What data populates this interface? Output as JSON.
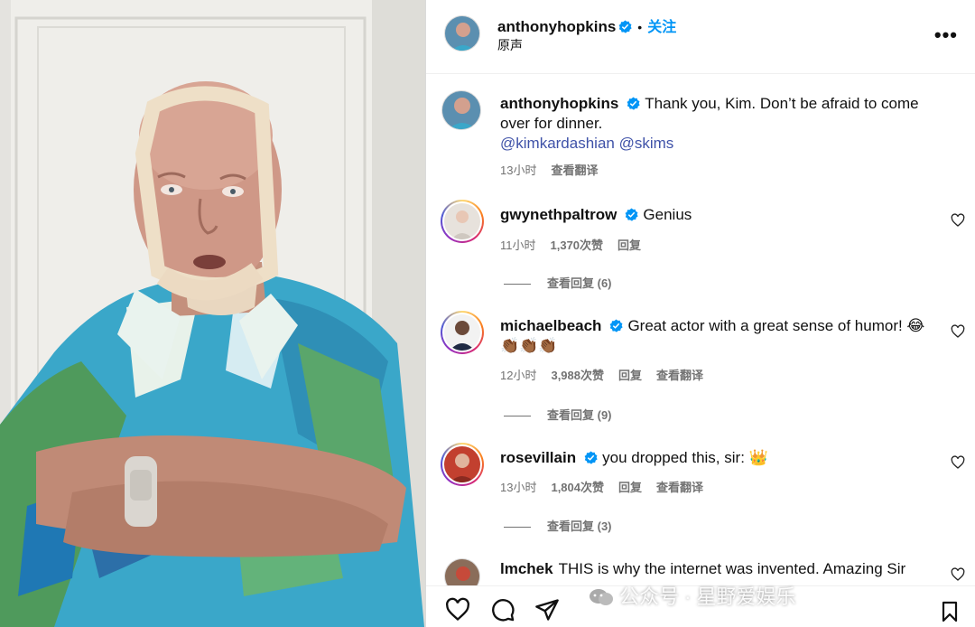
{
  "post": {
    "author": "anthonyhopkins",
    "dot": "•",
    "follow_label": "关注",
    "audio_label": "原声",
    "more_label": "•••"
  },
  "caption": {
    "username": "anthonyhopkins",
    "text": "Thank you, Kim. Don’t be afraid to come over for dinner.",
    "mentions": "@kimkardashian @skims",
    "time": "13小时",
    "translate": "查看翻译"
  },
  "comments": [
    {
      "username": "gwynethpaltrow",
      "text": "Genius",
      "time": "11小时",
      "likes": "1,370次赞",
      "reply": "回复",
      "translate": "",
      "view_replies": "查看回复 (6)"
    },
    {
      "username": "michaelbeach",
      "text": "Great actor with a great sense of humor! 😂",
      "text2": "👏🏾👏🏾👏🏾",
      "time": "12小时",
      "likes": "3,988次赞",
      "reply": "回复",
      "translate": "查看翻译",
      "view_replies": "查看回复 (9)"
    },
    {
      "username": "rosevillain",
      "text": "you dropped this, sir: 👑",
      "time": "13小时",
      "likes": "1,804次赞",
      "reply": "回复",
      "translate": "查看翻译",
      "view_replies": "查看回复 (3)"
    },
    {
      "username": "lmchek",
      "text": "THIS is why the internet was invented. Amazing Sir"
    }
  ],
  "watermark": "公众号 · 星野爱娱乐",
  "colors": {
    "accent": "#0095f6",
    "verified": "#0095f6",
    "mention": "#3f52a8",
    "meta": "#737373"
  }
}
